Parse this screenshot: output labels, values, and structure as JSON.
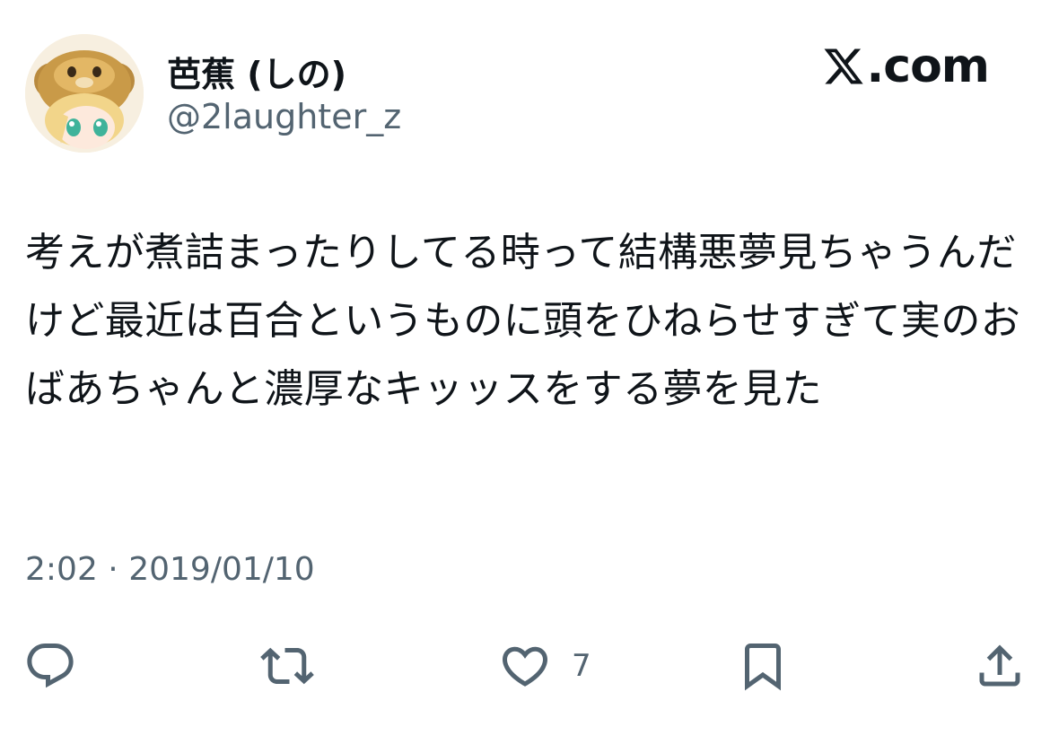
{
  "author": {
    "display_name": "芭蕉 (しの)",
    "handle": "@2laughter_z",
    "avatar_icon": "lion-hood-anime-avatar"
  },
  "brand": {
    "logo_icon": "x-logo-icon",
    "suffix": ".com"
  },
  "tweet": {
    "text": "考えが煮詰まったりしてる時って結構悪夢見ちゃうんだけど最近は百合というものに頭をひねらせすぎて実のおばあちゃんと濃厚なキッッスをする夢を見た"
  },
  "meta": {
    "time": "2:02",
    "separator": "·",
    "date": "2019/01/10"
  },
  "actions": {
    "reply": {
      "icon": "reply-icon"
    },
    "retweet": {
      "icon": "retweet-icon"
    },
    "like": {
      "icon": "heart-icon",
      "count": "7"
    },
    "bookmark": {
      "icon": "bookmark-icon"
    },
    "share": {
      "icon": "share-icon"
    }
  },
  "colors": {
    "text": "#0f1419",
    "secondary": "#536471"
  }
}
